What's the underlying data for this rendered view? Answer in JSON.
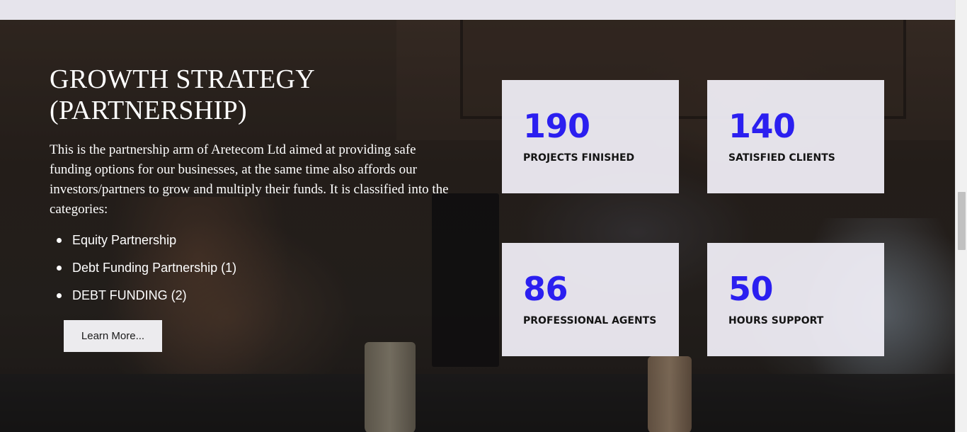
{
  "section": {
    "heading_line1": "GROWTH STRATEGY",
    "heading_line2": "(PARTNERSHIP)",
    "description": "This is the partnership arm of Aretecom Ltd aimed at providing safe funding options for our businesses, at the same time also affords our investors/partners to grow and multiply their funds. It is classified into the categories:",
    "categories": [
      "Equity Partnership",
      "Debt Funding Partnership (1)",
      "DEBT FUNDING (2)"
    ],
    "button_label": "Learn More..."
  },
  "stats": [
    {
      "number": "190",
      "label": "PROJECTS FINISHED"
    },
    {
      "number": "140",
      "label": "SATISFIED CLIENTS"
    },
    {
      "number": "86",
      "label": "PROFESSIONAL AGENTS"
    },
    {
      "number": "50",
      "label": "HOURS SUPPORT"
    }
  ],
  "colors": {
    "stat_number": "#2b1ff0",
    "card_background": "#f0eef6",
    "page_strip": "#e6e4ec"
  }
}
